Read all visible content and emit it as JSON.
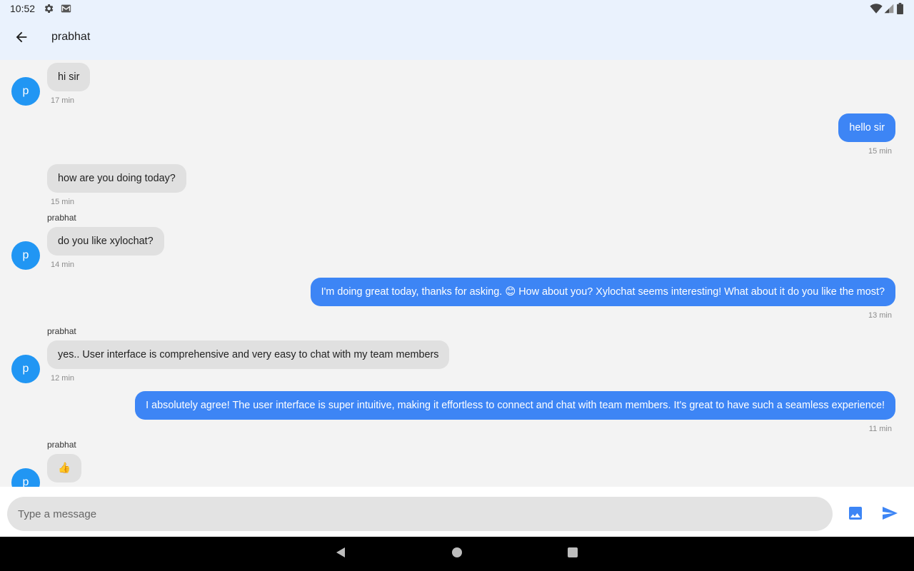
{
  "status_bar": {
    "time": "10:52",
    "left_icons": [
      "settings-icon",
      "gmail-icon"
    ],
    "right_icons": [
      "wifi-icon",
      "signal-icon",
      "battery-icon"
    ]
  },
  "app_bar": {
    "title": "prabhat",
    "back_icon": "arrow-back-icon"
  },
  "colors": {
    "header_bg": "#eaf2fd",
    "outgoing_bubble": "#3d85f5",
    "incoming_bubble": "#e0e0e0",
    "avatar": "#2196f3",
    "accent": "#3d85f5"
  },
  "messages": [
    {
      "direction": "in",
      "avatar": "p",
      "text": "hi sir",
      "time": "17 min"
    },
    {
      "direction": "out",
      "text": "hello sir",
      "time": "15 min"
    },
    {
      "direction": "in",
      "text": "how are you doing today?",
      "time": "15 min"
    },
    {
      "direction": "in",
      "sender": "prabhat",
      "avatar": "p",
      "text": "do you like xylochat?",
      "time": "14 min"
    },
    {
      "direction": "out",
      "text": "I'm doing great today, thanks for asking. 😊 How about you?  Xylochat seems interesting! What about it do you like the most?",
      "time": "13 min"
    },
    {
      "direction": "in",
      "sender": "prabhat",
      "avatar": "p",
      "text": "yes.. User interface is comprehensive and very easy to chat with my team members",
      "time": "12 min"
    },
    {
      "direction": "out",
      "text": "I absolutely agree! The user interface is super intuitive, making it effortless to connect and chat with team members. It's great to have such a seamless experience!",
      "time": "11 min"
    },
    {
      "direction": "in",
      "sender": "prabhat",
      "avatar": "p",
      "text": "👍"
    }
  ],
  "composer": {
    "placeholder": "Type a message",
    "image_icon": "image-icon",
    "send_icon": "send-icon"
  },
  "nav_bar": {
    "icons": [
      "back-triangle-icon",
      "home-circle-icon",
      "recents-square-icon"
    ]
  }
}
